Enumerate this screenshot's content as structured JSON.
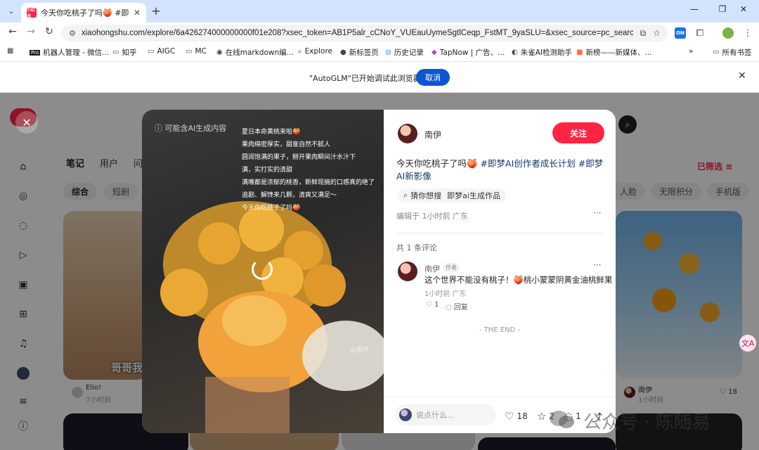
{
  "browser": {
    "tab_title": "今天你吃桃子了吗🍑 #即梦AI创",
    "favicon_text": "小红书",
    "url": "xiaohongshu.com/explore/6a426274000000000f01e208?xsec_token=AB1P5alr_cCNoY_VUEauUymeSgtlCeqp_FstMT_9yaSLU=&xsec_source=pc_search&...",
    "ext_on_label": "ON",
    "bookmarks": [
      "机器人管理 - 微信...",
      "知乎",
      "AIGC",
      "MC",
      "在线markdown编...",
      "Explore",
      "新标签页",
      "历史记录",
      "TapNow | 广告、...",
      "朱雀AI检测助手",
      "新榜——新媒体、..."
    ],
    "bookmarks_more": "»",
    "all_bookmarks": "所有书签",
    "infobar_text": "\"AutoGLM\"已开始调试此浏览器",
    "infobar_cancel": "取消"
  },
  "page": {
    "tabs": [
      "笔记",
      "用户",
      "问"
    ],
    "filter": "已筛选",
    "chips_left": [
      "综合",
      "短剧"
    ],
    "chips_right": [
      "人脸",
      "无限积分",
      "手机版"
    ],
    "card_left_caption": "哥哥我",
    "card_left_author": "Elio!",
    "card_left_time": "7小时前",
    "card_right_author": "南伊",
    "card_right_time": "1小时前",
    "card_right_likes": "18"
  },
  "media": {
    "ai_warning": "可能含AI生成内容",
    "overlay_lines": [
      "夏日本命黄桃来啦🍑",
      "果肉绵密厚实，甜度自然不腻人",
      "圆润饱满的果子，掰开果肉瞬间汁水汁下",
      "满，实打实的清甜",
      "满嘴都是浓郁的桃香，新鲜现摘的口感真的绝了",
      "追剧、解馋来几颗，清爽又满足～",
      "今天你吃桃子了吗🍑"
    ],
    "watermark": "@南伊"
  },
  "note": {
    "author": "南伊",
    "follow_label": "关注",
    "title_plain": "今天你吃桃子了吗🍑 ",
    "title_tags": "#即梦AI创作者成长计划 #即梦AI新影像",
    "query_label": "猜你想搜",
    "query_text": "即梦ai生成作品",
    "edited": "编辑于 1小时前 广东",
    "more": "···",
    "comment_count": "共 1 条评论",
    "comment": {
      "name": "南伊",
      "badge": "作者",
      "text": "这个世界不能没有桃子！🍑桃小蒙蒙阴黄金油桃鲜果",
      "time": "1小时前 广东",
      "likes": "1",
      "reply": "回复"
    },
    "the_end": "- THE END -",
    "input_placeholder": "说点什么...",
    "like_count": "18",
    "collect_count": "2",
    "comment_count_num": "1"
  },
  "overlay_watermark": "公众号 · 陈随易",
  "colors": {
    "brand": "#ff2442",
    "accent_blue": "#0b57d0",
    "tag_blue": "#13386c"
  }
}
